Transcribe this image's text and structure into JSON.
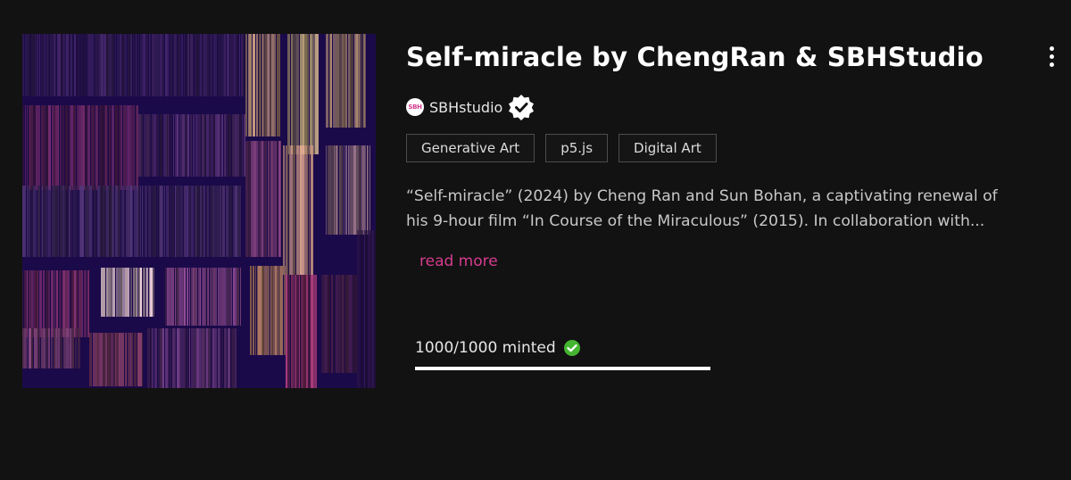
{
  "artwork": {
    "alt": "Self-miracle artwork preview",
    "colors": {
      "background": "#1b0a4a"
    }
  },
  "title": "Self-miracle by ChengRan & SBHStudio",
  "more_menu_icon": "kebab-vertical-icon",
  "artist": {
    "avatar_text": "SBH",
    "name": "SBHstudio",
    "verified_icon": "verified-badge-icon"
  },
  "tags": [
    "Generative Art",
    "p5.js",
    "Digital Art"
  ],
  "description": {
    "line1": "“Self-miracle” (2024) by Cheng Ran and Sun Bohan, a captivating renewal of",
    "line2": "his 9-hour film “In Course of the Miraculous” (2015). In collaboration with..."
  },
  "read_more": "read more",
  "mint": {
    "text": "1000/1000 minted",
    "status_icon": "check-circle-icon",
    "minted": 1000,
    "total": 1000,
    "progress_fraction": 1.0
  },
  "colors": {
    "accent": "#d63c8e",
    "success": "#44b530",
    "background": "#121212"
  }
}
